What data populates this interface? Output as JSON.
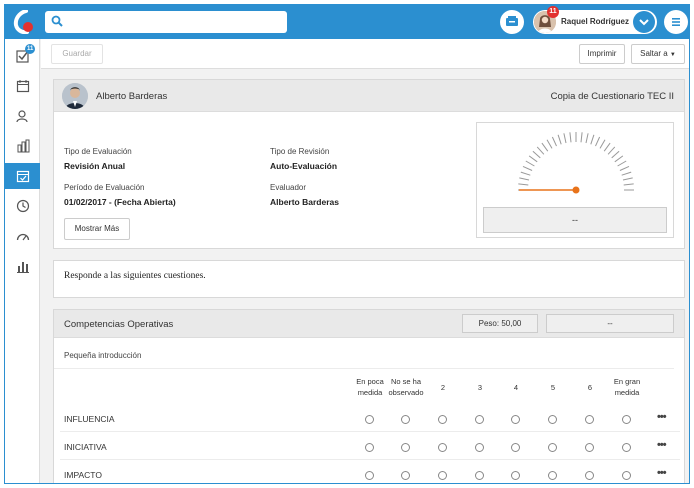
{
  "header": {
    "search_placeholder": "",
    "user_name": "Raquel Rodríguez",
    "notification_count": "11"
  },
  "sidebar": {
    "items": [
      {
        "icon": "checklist-icon",
        "badge": "11"
      },
      {
        "icon": "calendar-icon"
      },
      {
        "icon": "users-icon"
      },
      {
        "icon": "building-icon"
      },
      {
        "icon": "calendar-check-icon",
        "active": true
      },
      {
        "icon": "clock-icon"
      },
      {
        "icon": "gauge-icon"
      },
      {
        "icon": "bar-chart-icon"
      }
    ]
  },
  "toolbar": {
    "save_label": "Guardar",
    "print_label": "Imprimir",
    "jump_label": "Saltar a"
  },
  "evaluation": {
    "employee_name": "Alberto Barderas",
    "questionnaire_title": "Copia de Cuestionario TEC II",
    "type_label": "Tipo de Evaluación",
    "type_value": "Revisión Anual",
    "review_type_label": "Tipo de Revisión",
    "review_type_value": "Auto-Evaluación",
    "period_label": "Período de Evaluación",
    "period_value": "01/02/2017 - (Fecha Abierta)",
    "evaluator_label": "Evaluador",
    "evaluator_value": "Alberto Barderas",
    "show_more_label": "Mostrar Más",
    "gauge_result": "--"
  },
  "instructions": {
    "text": "Responde a las siguientes cuestiones."
  },
  "competencies": {
    "title": "Competencias Operativas",
    "weight": "Peso: 50,00",
    "score": "--",
    "intro": "Pequeña introducción",
    "scale": [
      "En poca medida",
      "No se ha observado",
      "2",
      "3",
      "4",
      "5",
      "6",
      "En gran medida"
    ],
    "rows": [
      {
        "label": "INFLUENCIA"
      },
      {
        "label": "INICIATIVA"
      },
      {
        "label": "IMPACTO"
      }
    ],
    "more_label": "•••"
  },
  "colors": {
    "brand": "#2b8fd0",
    "badge": "#e2312f",
    "gauge_needle": "#e8731a"
  }
}
